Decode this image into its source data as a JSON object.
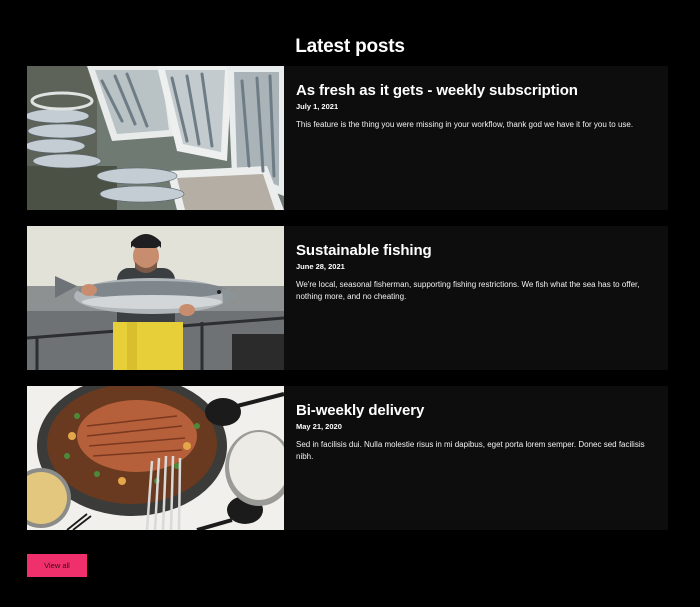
{
  "section": {
    "heading": "Latest posts"
  },
  "posts": [
    {
      "title": "As fresh as it gets - weekly subscription",
      "date": "July 1, 2021",
      "excerpt": "This feature is the thing you were missing in your workflow, thank god we have it for you to use."
    },
    {
      "title": "Sustainable fishing",
      "date": "June 28, 2021",
      "excerpt": "We're local, seasonal fisherman, supporting fishing restrictions. We fish what the sea has to offer, nothing more, and no cheating."
    },
    {
      "title": "Bi-weekly delivery",
      "date": "May 21, 2020",
      "excerpt": "Sed in facilisis dui. Nulla molestie risus in mi dapibus, eget porta lorem semper. Donec sed facilisis nibh."
    }
  ],
  "actions": {
    "view_all_label": "View all"
  },
  "colors": {
    "page_background": "#000000",
    "card_background": "#0d0d0d",
    "accent": "#f0306c",
    "text": "#ffffff"
  }
}
